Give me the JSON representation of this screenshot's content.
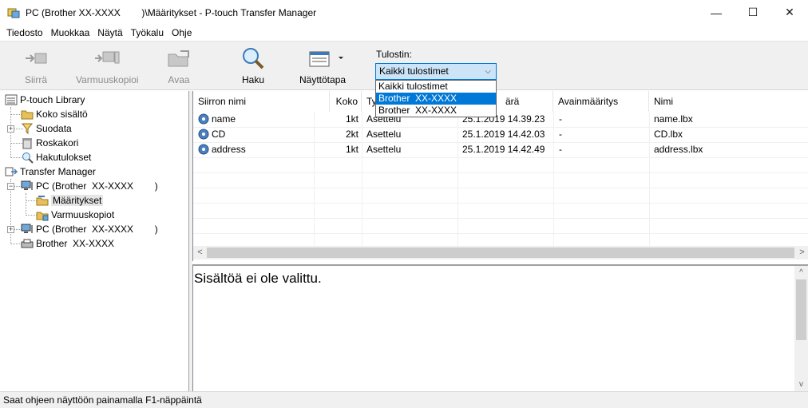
{
  "window": {
    "title": "PC (Brother XX-XXXX        )\\Määritykset - P-touch Transfer Manager",
    "minimize": "—",
    "maximize": "☐",
    "close": "✕"
  },
  "menu": [
    {
      "label": "Tiedosto"
    },
    {
      "label": "Muokkaa"
    },
    {
      "label": "Näytä"
    },
    {
      "label": "Työkalu"
    },
    {
      "label": "Ohje"
    }
  ],
  "toolbar": {
    "transfer": "Siirrä",
    "backup": "Varmuuskopioi",
    "open": "Avaa",
    "search": "Haku",
    "view": "Näyttötapa",
    "printer_label": "Tulostin:",
    "printer_selected": "Kaikki tulostimet",
    "printer_options": [
      "Kaikki tulostimet",
      "Brother  XX-XXXX",
      "Brother  XX-XXXX"
    ]
  },
  "tree": {
    "library": "P-touch Library",
    "all_contents": "Koko sisältö",
    "filter": "Suodata",
    "recycle": "Roskakori",
    "search_results": "Hakutulokset",
    "transfer_manager": "Transfer Manager",
    "pc1": "PC (Brother  XX-XXXX        )",
    "configurations": "Määritykset",
    "backups": "Varmuuskopiot",
    "pc2": "PC (Brother  XX-XXXX        )",
    "brother": "Brother  XX-XXXX"
  },
  "list": {
    "columns": [
      "Siirron nimi",
      "Koko",
      "Ty",
      "ärä",
      "Avainmääritys",
      "Nimi"
    ],
    "rows": [
      {
        "name": "name",
        "size": "1kt",
        "type": "Asettelu",
        "date": "25.1.2019 14.39.23",
        "key": "-",
        "file": "name.lbx"
      },
      {
        "name": "CD",
        "size": "2kt",
        "type": "Asettelu",
        "date": "25.1.2019 14.42.03",
        "key": "-",
        "file": "CD.lbx"
      },
      {
        "name": "address",
        "size": "1kt",
        "type": "Asettelu",
        "date": "25.1.2019 14.42.49",
        "key": "-",
        "file": "address.lbx"
      }
    ]
  },
  "preview": {
    "message": "Sisältöä ei ole valittu."
  },
  "status": {
    "text": "Saat ohjeen näyttöön painamalla F1-näppäintä"
  },
  "colors": {
    "accent": "#0078d7",
    "select_bg": "#cce4f7"
  }
}
